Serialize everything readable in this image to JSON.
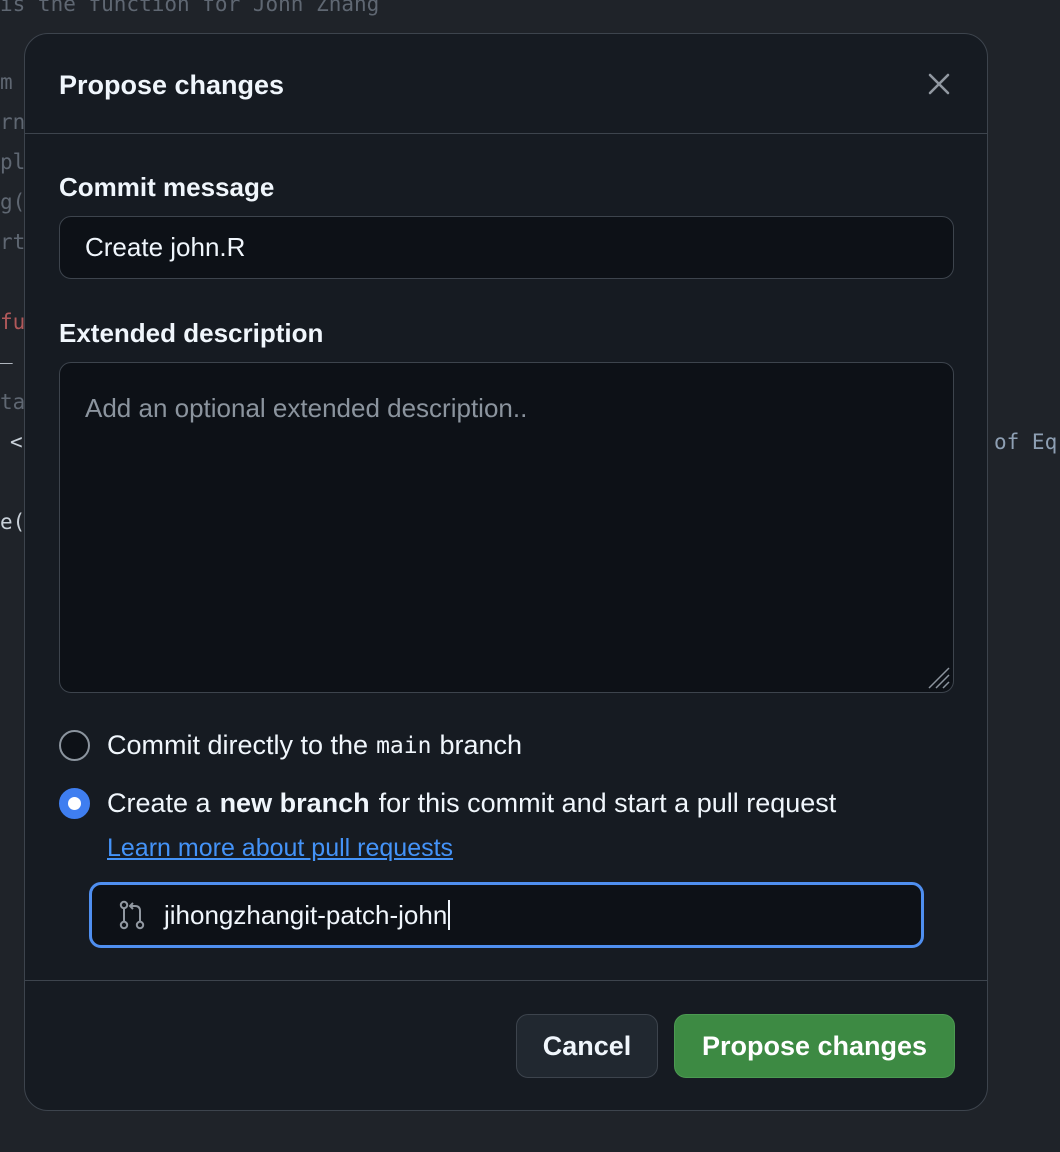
{
  "background": {
    "top_line": "is the function for John Zhang",
    "fragments": [
      "m",
      "rn",
      "pl",
      "g(",
      "rt",
      "fu",
      "_",
      "ta",
      "<",
      "e(",
      "of Eq"
    ]
  },
  "dialog": {
    "title": "Propose changes",
    "close_icon": "x-icon",
    "commit_message": {
      "label": "Commit message",
      "value": "Create john.R"
    },
    "extended_description": {
      "label": "Extended description",
      "placeholder": "Add an optional extended description.."
    },
    "options": {
      "direct": {
        "prefix": "Commit directly to the",
        "branch": "main",
        "suffix": "branch",
        "selected": false
      },
      "new_branch": {
        "prefix": "Create a",
        "emphasis": "new branch",
        "suffix": "for this commit and start a pull request",
        "selected": true
      }
    },
    "learn_more": "Learn more about pull requests",
    "branch_name": {
      "icon": "git-pull-request-icon",
      "value": "jihongzhangit-patch-john"
    },
    "buttons": {
      "cancel": "Cancel",
      "propose": "Propose changes"
    }
  },
  "colors": {
    "accent": "#3f7ef0",
    "primary_button": "#3d8a43",
    "link": "#4493f8"
  }
}
